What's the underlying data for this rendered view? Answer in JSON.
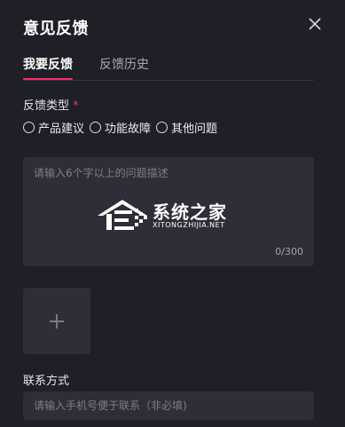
{
  "dialog": {
    "title": "意见反馈",
    "close_icon": "close-icon"
  },
  "tabs": [
    {
      "label": "我要反馈",
      "active": true
    },
    {
      "label": "反馈历史",
      "active": false
    }
  ],
  "feedback_type": {
    "label": "反馈类型",
    "required_mark": "*",
    "options": [
      {
        "label": "产品建议",
        "selected": false
      },
      {
        "label": "功能故障",
        "selected": false
      },
      {
        "label": "其他问题",
        "selected": false
      }
    ]
  },
  "description": {
    "placeholder": "请输入6个字以上的问题描述",
    "counter": "0/300"
  },
  "watermark": {
    "text_cn": "系统之家",
    "text_en": "XITONGZHIJIA.NET"
  },
  "upload": {
    "icon": "plus-icon"
  },
  "contact": {
    "label": "联系方式",
    "placeholder": "请输入手机号便于联系（非必填)"
  },
  "colors": {
    "background": "#1f1f27",
    "field": "#2e2e38",
    "accent": "#ff2b6b",
    "text": "#e9e9ef",
    "muted": "#7e7e8b"
  }
}
